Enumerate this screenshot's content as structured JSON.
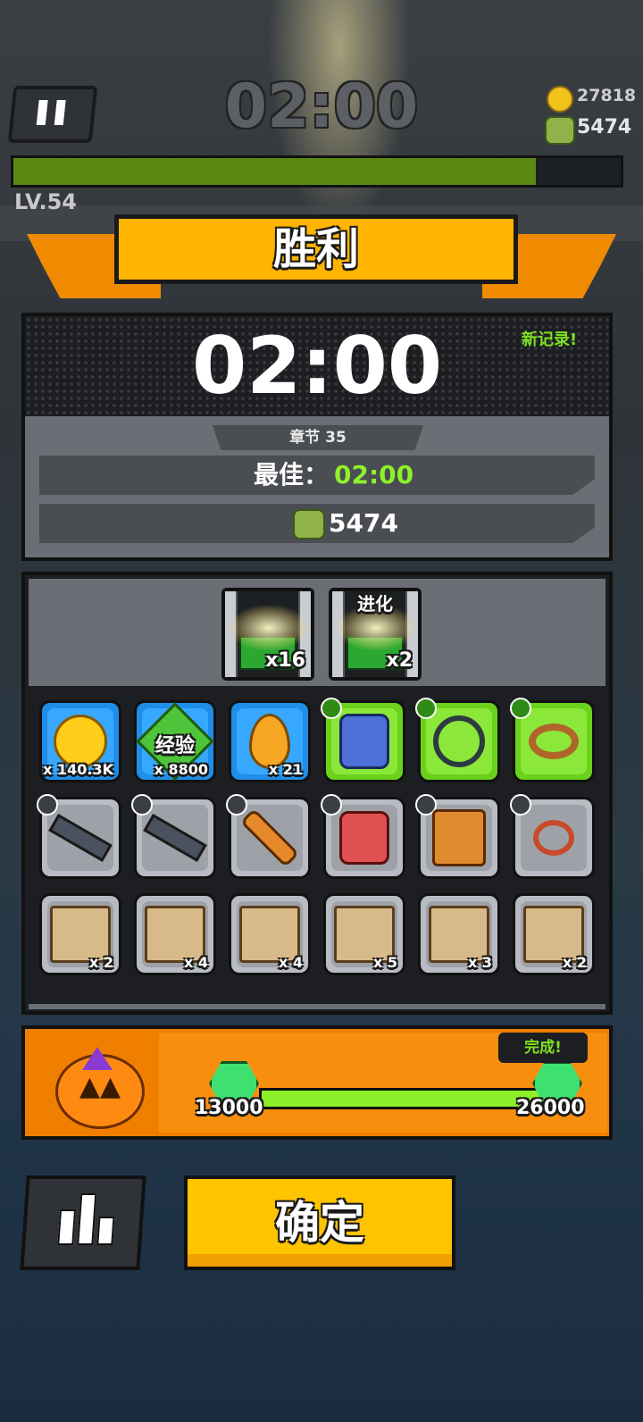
{
  "hud": {
    "timer": "02:00",
    "coins": "27818",
    "kills": "5474",
    "level": "LV.54",
    "xp_progress": 0.86
  },
  "banner": {
    "title": "胜利"
  },
  "result": {
    "time": "02:00",
    "new_record": "新记录!",
    "chapter": "章节 35",
    "best_label": "最佳：",
    "best_value": "02:00",
    "kills": "5474"
  },
  "chests": [
    {
      "qty": "x16",
      "label": ""
    },
    {
      "qty": "x2",
      "label": "进化"
    }
  ],
  "rewards": {
    "row1": [
      {
        "kind": "coin",
        "rarity": "blue",
        "count": "x 140.3K",
        "icon": "gold-coin-icon"
      },
      {
        "kind": "exp",
        "rarity": "blue",
        "count": "x 8800",
        "label": "经验",
        "icon": "exp-gem-icon"
      },
      {
        "kind": "essence",
        "rarity": "blue",
        "count": "x 21",
        "icon": "orange-drop-icon"
      },
      {
        "kind": "gear",
        "rarity": "green",
        "count": "",
        "icon": "armor-vest-icon"
      },
      {
        "kind": "gear",
        "rarity": "green",
        "count": "",
        "icon": "necklace-icon"
      },
      {
        "kind": "gear",
        "rarity": "green",
        "count": "",
        "icon": "belt-icon"
      }
    ],
    "row2": [
      {
        "kind": "gear",
        "rarity": "grey",
        "count": "",
        "icon": "shotgun-icon"
      },
      {
        "kind": "gear",
        "rarity": "grey",
        "count": "",
        "icon": "shotgun-icon"
      },
      {
        "kind": "gear",
        "rarity": "grey",
        "count": "",
        "icon": "baseball-bat-icon"
      },
      {
        "kind": "gear",
        "rarity": "grey",
        "count": "",
        "icon": "red-armor-icon"
      },
      {
        "kind": "gear",
        "rarity": "grey",
        "count": "",
        "icon": "jacket-icon"
      },
      {
        "kind": "gear",
        "rarity": "grey",
        "count": "",
        "icon": "bone-necklace-icon"
      }
    ],
    "row3": [
      {
        "kind": "scroll",
        "rarity": "grey",
        "count": "x 2",
        "icon": "weapon-scroll-icon"
      },
      {
        "kind": "scroll",
        "rarity": "grey",
        "count": "x 4",
        "icon": "armor-scroll-icon"
      },
      {
        "kind": "scroll",
        "rarity": "grey",
        "count": "x 4",
        "icon": "necklace-scroll-icon"
      },
      {
        "kind": "scroll",
        "rarity": "grey",
        "count": "x 5",
        "icon": "belt-scroll-icon"
      },
      {
        "kind": "scroll",
        "rarity": "grey",
        "count": "x 3",
        "icon": "glove-scroll-icon"
      },
      {
        "kind": "scroll",
        "rarity": "grey",
        "count": "x 2",
        "icon": "boots-scroll-icon"
      }
    ]
  },
  "event": {
    "complete": "完成!",
    "start_value": "13000",
    "end_value": "26000",
    "progress": 1.0
  },
  "buttons": {
    "confirm": "确定"
  },
  "colors": {
    "banner": "#ffb400",
    "accent_green": "#8ef02a",
    "confirm": "#ffc400",
    "event_orange": "#f07f00"
  }
}
